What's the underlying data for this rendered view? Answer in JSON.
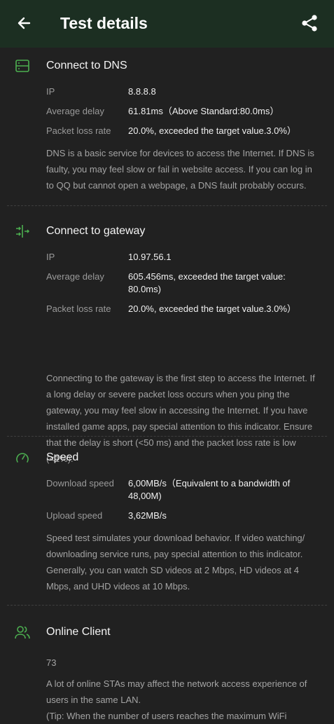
{
  "header": {
    "title": "Test details"
  },
  "icons": {
    "back": "arrow-left-icon",
    "share": "share-icon",
    "dns": "server-icon",
    "gateway": "gateway-icon",
    "speed": "speedometer-icon",
    "clients": "users-icon"
  },
  "colors": {
    "accent": "#4caf50",
    "appbar": "#1c2f22",
    "background": "#212121"
  },
  "dns": {
    "title": "Connect to DNS",
    "rows": [
      {
        "label": "IP",
        "value": "8.8.8.8"
      },
      {
        "label": "Average delay",
        "value": "61.81ms（Above Standard:80.0ms）"
      },
      {
        "label": "Packet loss rate",
        "value": "20.0%, exceeded the target value.3.0%）"
      }
    ],
    "desc": "DNS is a basic service for devices to access the Internet. If DNS is faulty, you may feel slow or fail in website access. If you can log in to QQ but cannot open a webpage, a DNS fault probably occurs."
  },
  "gateway": {
    "title": "Connect to gateway",
    "rows": [
      {
        "label": "IP",
        "value": "10.97.56.1"
      },
      {
        "label": "Average delay",
        "value": "605.456ms, exceeded the target value: 80.0ms)"
      },
      {
        "label": "Packet loss rate",
        "value": "20.0%, exceeded the target value.3.0%）"
      }
    ],
    "desc": "Connecting to the gateway is the first step to access the Internet. If a long delay or severe packet loss occurs when you ping the gateway, you may feel slow in accessing the Internet. If you have installed game apps, pay special attention to this indicator. Ensure that the delay is short (<50 ms) and the packet loss rate is low (<1%)."
  },
  "speed": {
    "title": "Speed",
    "rows": [
      {
        "label": "Download speed",
        "value": "6,00MB/s（Equivalent to a bandwidth of 48,00M)"
      },
      {
        "label": "Upload speed",
        "value": "3,62MB/s"
      }
    ],
    "desc": "Speed test simulates your download behavior. If video watching/ downloading service runs, pay special attention to this indicator. Generally, you can watch SD videos at 2 Mbps, HD videos at 4 Mbps, and UHD videos at 10 Mbps."
  },
  "clients": {
    "title": "Online Client",
    "count": "73",
    "desc": "A lot of online STAs may affect the network access experience of users in the same LAN.",
    "tip": "(Tip: When the number of users reaches the maximum WiFi"
  }
}
